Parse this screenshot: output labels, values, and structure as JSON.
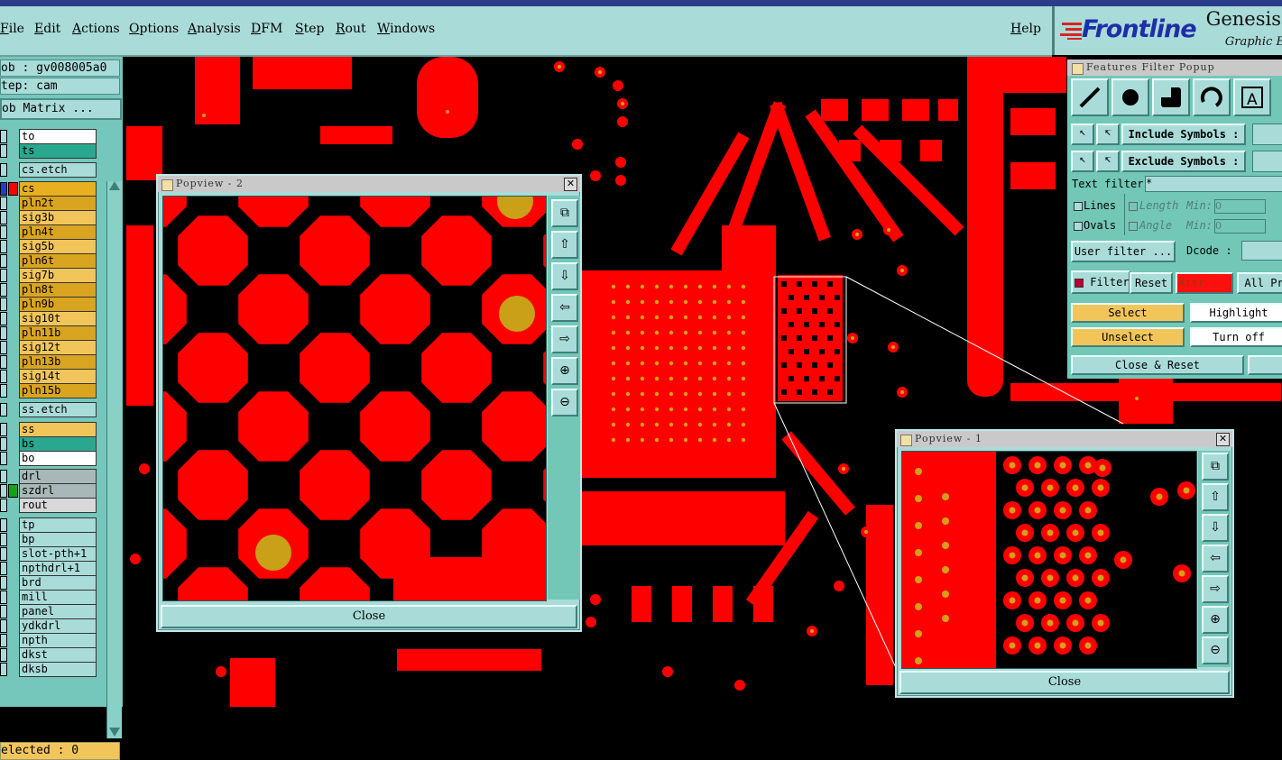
{
  "menu": [
    "File",
    "Edit",
    "Actions",
    "Options",
    "Analysis",
    "DFM",
    "Step",
    "Rout",
    "Windows"
  ],
  "help": "Help",
  "brand": {
    "logo": "Frontline",
    "name": "Genesis",
    "sub": "Graphic E"
  },
  "job": {
    "job_label": "ob : gv008005a0",
    "step_label": "tep: cam",
    "matrix_button": "ob Matrix ..."
  },
  "layers": [
    {
      "name": "to",
      "bg": "#ffffff"
    },
    {
      "name": "ts",
      "bg": "#2aa88f"
    },
    {
      "name": "cs.etch",
      "bg": "#a9dcd9"
    },
    {
      "name": "cs",
      "bg": "#e8b020",
      "active": true
    },
    {
      "name": "pln2t",
      "bg": "#d9a520"
    },
    {
      "name": "sig3b",
      "bg": "#f2c55a"
    },
    {
      "name": "pln4t",
      "bg": "#d9a520"
    },
    {
      "name": "sig5b",
      "bg": "#f2c55a"
    },
    {
      "name": "pln6t",
      "bg": "#d9a520"
    },
    {
      "name": "sig7b",
      "bg": "#f2c55a"
    },
    {
      "name": "pln8t",
      "bg": "#d9a520"
    },
    {
      "name": "pln9b",
      "bg": "#d9a520"
    },
    {
      "name": "sig10t",
      "bg": "#f2c55a"
    },
    {
      "name": "pln11b",
      "bg": "#d9a520"
    },
    {
      "name": "sig12t",
      "bg": "#f2c55a"
    },
    {
      "name": "pln13b",
      "bg": "#d9a520"
    },
    {
      "name": "sig14t",
      "bg": "#f2c55a"
    },
    {
      "name": "pln15b",
      "bg": "#d9a520"
    },
    {
      "name": "ss.etch",
      "bg": "#a9dcd9"
    },
    {
      "name": "ss",
      "bg": "#f2c55a"
    },
    {
      "name": "bs",
      "bg": "#2aa88f"
    },
    {
      "name": "bo",
      "bg": "#ffffff"
    },
    {
      "name": "drl",
      "bg": "#a8b8b8"
    },
    {
      "name": "szdrl",
      "bg": "#a8b8b8"
    },
    {
      "name": "rout",
      "bg": "#d8d8d8"
    },
    {
      "name": "tp",
      "bg": "#a9dcd9"
    },
    {
      "name": "bp",
      "bg": "#a9dcd9"
    },
    {
      "name": "slot-pth+1",
      "bg": "#a9dcd9"
    },
    {
      "name": "npthdrl+1",
      "bg": "#a9dcd9"
    },
    {
      "name": "brd",
      "bg": "#a9dcd9"
    },
    {
      "name": "mill",
      "bg": "#a9dcd9"
    },
    {
      "name": "panel",
      "bg": "#a9dcd9"
    },
    {
      "name": "ydkdrl",
      "bg": "#a9dcd9"
    },
    {
      "name": "npth",
      "bg": "#a9dcd9"
    },
    {
      "name": "dkst",
      "bg": "#a9dcd9"
    },
    {
      "name": "dksb",
      "bg": "#a9dcd9"
    }
  ],
  "selected": "elected : 0",
  "popview2": {
    "title": "Popview - 2",
    "close": "Close"
  },
  "popview1": {
    "title": "Popview - 1",
    "close": "Close"
  },
  "filter": {
    "title": "Features Filter Popup",
    "include": "Include Symbols :",
    "exclude": "Exclude Symbols :",
    "text_filter": "Text filter",
    "text_filter_value": "*",
    "lines": "Lines",
    "ovals": "Ovals",
    "length": "Length",
    "angle": "Angle",
    "min": "Min:",
    "min_value": "0",
    "user_filter": "User filter ...",
    "dcode": "Dcode :",
    "filter_btn": "Filter",
    "reset": "Reset",
    "attr": "Attr ...",
    "all": "All Pr",
    "select": "Select",
    "highlight": "Highlight",
    "unselect": "Unselect",
    "turn_off": "Turn off",
    "close_reset": "Close & Reset"
  },
  "colors": {
    "copper": "#ff0000",
    "pad_dot": "#d4a017",
    "board": "#000000",
    "ui": "#a9dcd9",
    "panel": "#73c7b7"
  }
}
